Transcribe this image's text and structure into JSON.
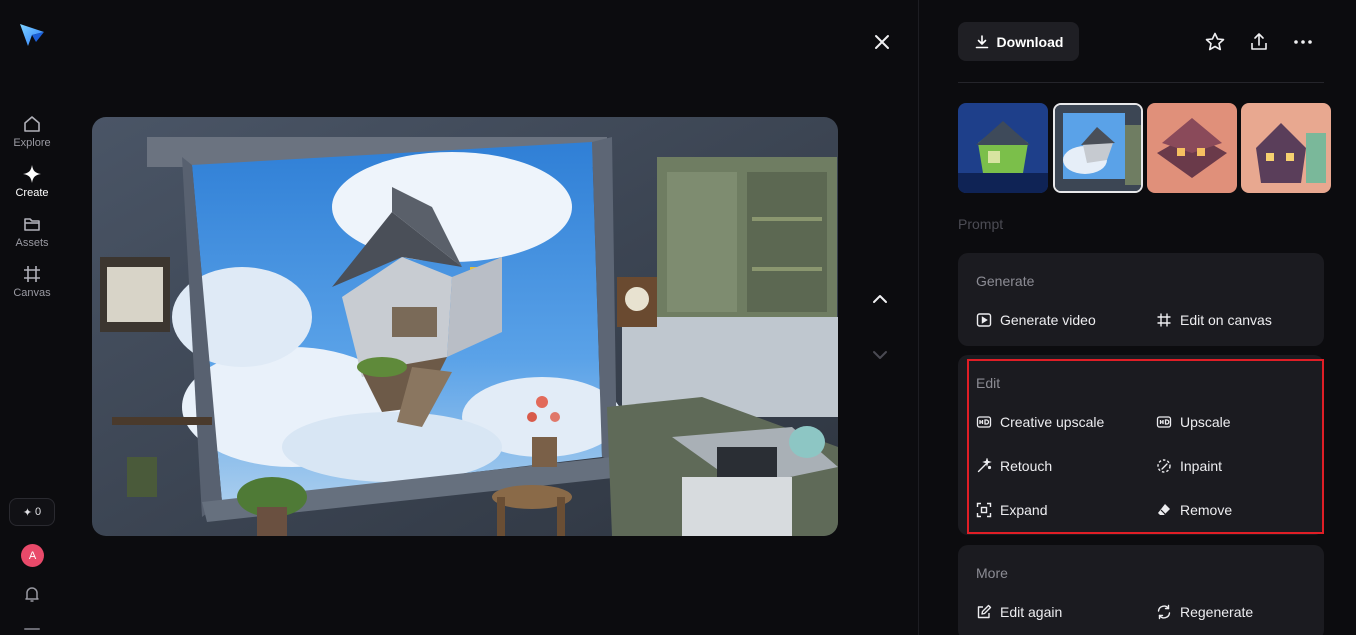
{
  "sidebar": {
    "items": [
      {
        "label": "Explore",
        "icon": "home-icon"
      },
      {
        "label": "Create",
        "icon": "sparkle-icon"
      },
      {
        "label": "Assets",
        "icon": "folder-icon"
      },
      {
        "label": "Canvas",
        "icon": "canvas-icon"
      }
    ],
    "credits": "0",
    "avatar_letter": "A"
  },
  "panel": {
    "download_label": "Download",
    "prompt_label": "Prompt",
    "generate": {
      "title": "Generate",
      "actions": [
        "Generate video",
        "Edit on canvas"
      ]
    },
    "edit": {
      "title": "Edit",
      "actions": [
        "Creative upscale",
        "Upscale",
        "Retouch",
        "Inpaint",
        "Expand",
        "Remove"
      ]
    },
    "more": {
      "title": "More",
      "actions": [
        "Edit again",
        "Regenerate"
      ]
    }
  },
  "colors": {
    "background": "#0c0c0f",
    "card": "#1b1b20",
    "highlight": "#e01e26",
    "accent_logo": "#3aa0ff",
    "avatar": "#e94a6a"
  }
}
